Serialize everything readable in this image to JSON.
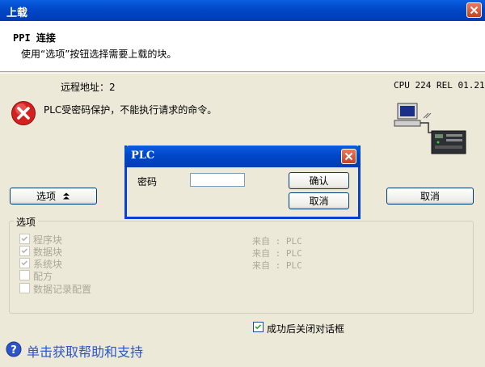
{
  "window": {
    "title": "上载"
  },
  "header": {
    "title": "PPI 连接",
    "subtitle": "使用“选项”按钮选择需要上载的块。"
  },
  "info": {
    "remote_address": "远程地址：2",
    "cpu_info": "CPU 224 REL 01.21"
  },
  "error": {
    "message": "PLC受密码保护，不能执行请求的命令。"
  },
  "buttons": {
    "options_label": "选项",
    "cancel_label": "取消"
  },
  "options": {
    "group_title": "选项",
    "items": [
      {
        "label": "程序块",
        "checked": true,
        "source": "来自 : PLC"
      },
      {
        "label": "数据块",
        "checked": true,
        "source": "来自 : PLC"
      },
      {
        "label": "系统块",
        "checked": true,
        "source": "来自 : PLC"
      },
      {
        "label": "配方",
        "checked": false,
        "source": ""
      },
      {
        "label": "数据记录配置",
        "checked": false,
        "source": ""
      }
    ]
  },
  "close_on_success": {
    "label": "成功后关闭对话框",
    "checked": true
  },
  "help": {
    "label": "单击获取帮助和支持"
  },
  "plc_dialog": {
    "title": "PLC",
    "password_label": "密码",
    "password_value": "",
    "ok_label": "确认",
    "cancel_label": "取消"
  },
  "colors": {
    "titlebar": "#0047c8",
    "error_red": "#d52020",
    "help_link": "#2d55c8",
    "dialog_bg": "#ece9d8"
  }
}
